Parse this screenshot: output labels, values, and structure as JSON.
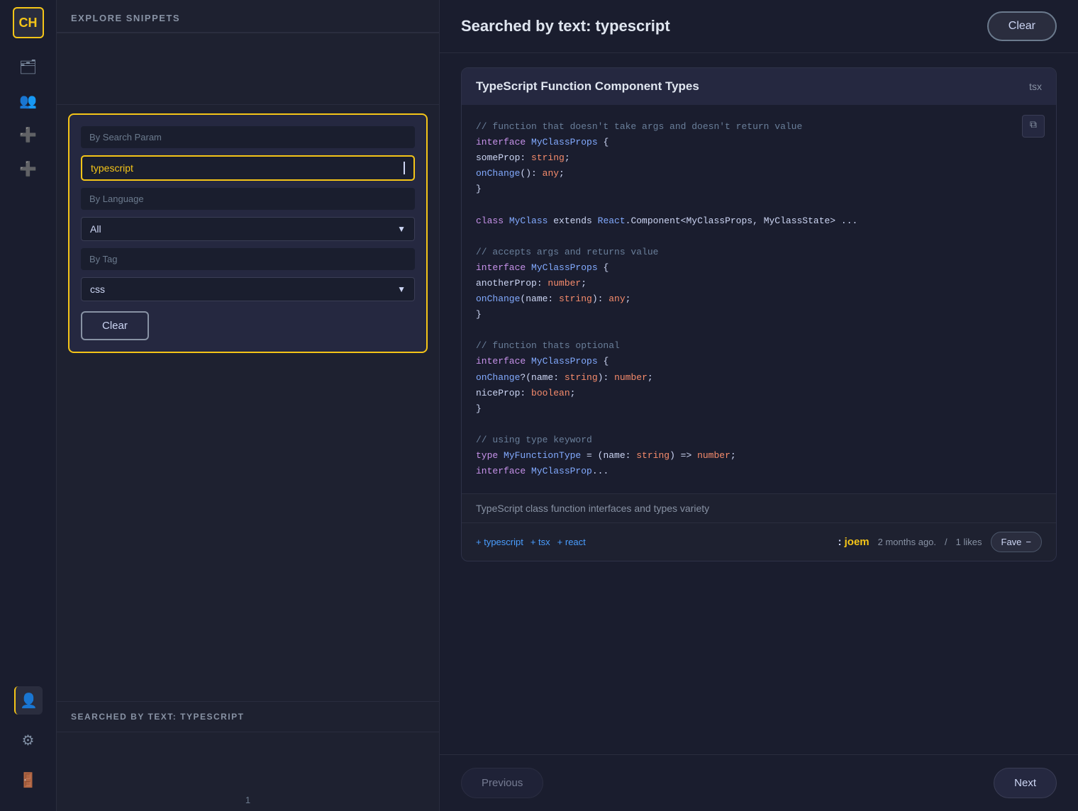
{
  "sidebar": {
    "logo": "CH",
    "icons": [
      {
        "name": "folder-icon",
        "symbol": "🗂",
        "active": false
      },
      {
        "name": "users-icon",
        "symbol": "👥",
        "active": false
      },
      {
        "name": "add-snippet-icon",
        "symbol": "➕",
        "active": false
      },
      {
        "name": "add-collection-icon",
        "symbol": "➕",
        "active": false
      }
    ],
    "bottom_icons": [
      {
        "name": "user-profile-icon",
        "symbol": "👤",
        "active": true
      },
      {
        "name": "settings-icon",
        "symbol": "⚙",
        "active": false
      },
      {
        "name": "logout-icon",
        "symbol": "🚪",
        "active": false
      }
    ]
  },
  "left_panel": {
    "header": "Explore Snippets",
    "search_form": {
      "by_search_param_label": "By Search Param",
      "search_value": "typescript",
      "by_language_label": "By Language",
      "language_value": "All",
      "by_tag_label": "By Tag",
      "tag_value": "css",
      "clear_label": "Clear"
    },
    "searched_label": "Searched By Text: TypeScript",
    "pagination_number": "1"
  },
  "main": {
    "title": "Searched by text: typescript",
    "clear_label": "Clear",
    "snippet": {
      "title": "TypeScript Function Component Types",
      "lang_badge": "tsx",
      "code_lines": [
        {
          "type": "comment",
          "text": "// function that doesn't take args and doesn't return value"
        },
        {
          "type": "code",
          "parts": [
            {
              "t": "keyword",
              "v": "interface "
            },
            {
              "t": "classname",
              "v": "MyClassProps"
            },
            {
              "t": "default",
              "v": " {"
            }
          ]
        },
        {
          "type": "code",
          "parts": [
            {
              "t": "default",
              "v": "  someProp"
            },
            {
              "t": "property",
              "v": ": "
            },
            {
              "t": "type",
              "v": "string"
            },
            {
              "t": "default",
              "v": ";"
            }
          ]
        },
        {
          "type": "code",
          "parts": [
            {
              "t": "default",
              "v": "  "
            },
            {
              "t": "classname",
              "v": "onChange"
            },
            {
              "t": "default",
              "v": "(): "
            },
            {
              "t": "type",
              "v": "any"
            },
            {
              "t": "default",
              "v": ";"
            }
          ]
        },
        {
          "type": "code",
          "parts": [
            {
              "t": "default",
              "v": "}"
            }
          ]
        },
        {
          "type": "blank"
        },
        {
          "type": "code",
          "parts": [
            {
              "t": "keyword",
              "v": "class "
            },
            {
              "t": "classname",
              "v": "MyClass"
            },
            {
              "t": "default",
              "v": " extends "
            },
            {
              "t": "classname",
              "v": "React"
            },
            {
              "t": "default",
              "v": ".Component<MyClassProps, MyClassState> ..."
            }
          ]
        },
        {
          "type": "blank"
        },
        {
          "type": "comment",
          "text": "// accepts args and returns value"
        },
        {
          "type": "code",
          "parts": [
            {
              "t": "keyword",
              "v": "interface "
            },
            {
              "t": "classname",
              "v": "MyClassProps"
            },
            {
              "t": "default",
              "v": " {"
            }
          ]
        },
        {
          "type": "code",
          "parts": [
            {
              "t": "default",
              "v": "  anotherProp"
            },
            {
              "t": "property",
              "v": ": "
            },
            {
              "t": "type",
              "v": "number"
            },
            {
              "t": "default",
              "v": ";"
            }
          ]
        },
        {
          "type": "code",
          "parts": [
            {
              "t": "default",
              "v": "  "
            },
            {
              "t": "classname",
              "v": "onChange"
            },
            {
              "t": "default",
              "v": "(name"
            },
            {
              "t": "property",
              "v": ": "
            },
            {
              "t": "type",
              "v": "string"
            },
            {
              "t": "default",
              "v": "): "
            },
            {
              "t": "type",
              "v": "any"
            },
            {
              "t": "default",
              "v": ";"
            }
          ]
        },
        {
          "type": "code",
          "parts": [
            {
              "t": "default",
              "v": "}"
            }
          ]
        },
        {
          "type": "blank"
        },
        {
          "type": "comment",
          "text": "// function thats optional"
        },
        {
          "type": "code",
          "parts": [
            {
              "t": "keyword",
              "v": "interface "
            },
            {
              "t": "classname",
              "v": "MyClassProps"
            },
            {
              "t": "default",
              "v": " {"
            }
          ]
        },
        {
          "type": "code",
          "parts": [
            {
              "t": "default",
              "v": "  "
            },
            {
              "t": "classname",
              "v": "onChange"
            },
            {
              "t": "default",
              "v": "?(name"
            },
            {
              "t": "property",
              "v": ": "
            },
            {
              "t": "type",
              "v": "string"
            },
            {
              "t": "default",
              "v": "): "
            },
            {
              "t": "type",
              "v": "number"
            },
            {
              "t": "default",
              "v": ";"
            }
          ]
        },
        {
          "type": "code",
          "parts": [
            {
              "t": "default",
              "v": "  niceProp"
            },
            {
              "t": "property",
              "v": ": "
            },
            {
              "t": "type",
              "v": "boolean"
            },
            {
              "t": "default",
              "v": ";"
            }
          ]
        },
        {
          "type": "code",
          "parts": [
            {
              "t": "default",
              "v": "}"
            }
          ]
        },
        {
          "type": "blank"
        },
        {
          "type": "comment",
          "text": "// using type keyword"
        },
        {
          "type": "code",
          "parts": [
            {
              "t": "keyword",
              "v": "type "
            },
            {
              "t": "classname",
              "v": "MyFunctionType"
            },
            {
              "t": "default",
              "v": " = (name"
            },
            {
              "t": "property",
              "v": ": "
            },
            {
              "t": "type",
              "v": "string"
            },
            {
              "t": "default",
              "v": ") => "
            },
            {
              "t": "type",
              "v": "number"
            },
            {
              "t": "default",
              "v": ";"
            }
          ]
        },
        {
          "type": "code",
          "parts": [
            {
              "t": "keyword",
              "v": "interface "
            },
            {
              "t": "classname",
              "v": "MyClassProp"
            },
            {
              "t": "default",
              "v": "..."
            }
          ]
        }
      ],
      "copy_icon": "⧉",
      "description": "TypeScript class function interfaces and types variety",
      "tags": [
        {
          "label": "+ typescript"
        },
        {
          "label": "+ tsx"
        },
        {
          "label": "+ react"
        }
      ],
      "author_prefix": ": ",
      "author": "joem",
      "timestamp": "2 months ago.",
      "likes_separator": "/",
      "likes": "1 likes",
      "fave_label": "Fave",
      "fave_minus": "−"
    },
    "pagination": {
      "previous_label": "Previous",
      "next_label": "Next"
    }
  }
}
